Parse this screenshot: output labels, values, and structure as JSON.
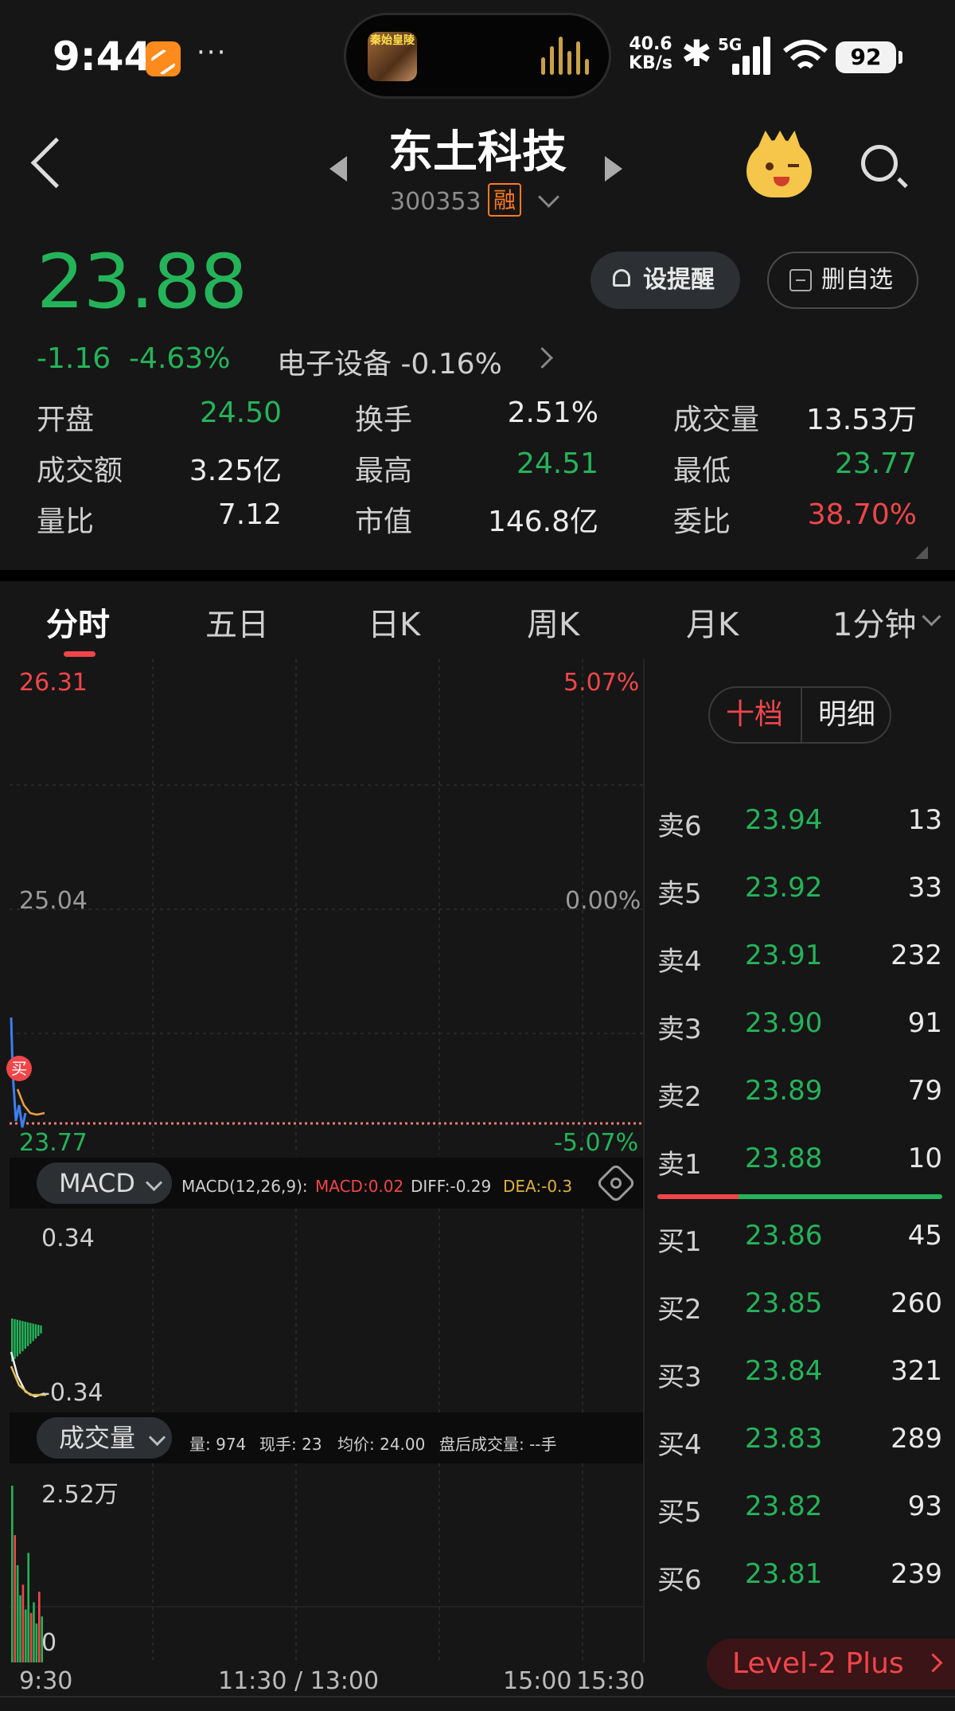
{
  "status_bar": {
    "time": "9:44",
    "dots": "···",
    "island_text": "秦始皇陵",
    "network_speed": "40.6",
    "network_unit": "KB/s",
    "bluetooth": "✱",
    "network_type": "5G",
    "battery": "92"
  },
  "header": {
    "stock_name": "东土科技",
    "stock_code": "300353",
    "margin_badge": "融"
  },
  "quote": {
    "price": "23.88",
    "change": "-1.16",
    "change_pct": "-4.63%",
    "sector": "电子设备 -0.16%",
    "alert_label": "设提醒",
    "remove_label": "删自选"
  },
  "stats": [
    {
      "label": "开盘",
      "value": "24.50",
      "color": "#25b35a"
    },
    {
      "label": "换手",
      "value": "2.51%",
      "color": "#ececec"
    },
    {
      "label": "成交量",
      "value": "13.53万",
      "color": "#ececec"
    },
    {
      "label": "成交额",
      "value": "3.25亿",
      "color": "#ececec"
    },
    {
      "label": "最高",
      "value": "24.51",
      "color": "#25b35a"
    },
    {
      "label": "最低",
      "value": "23.77",
      "color": "#25b35a"
    },
    {
      "label": "量比",
      "value": "7.12",
      "color": "#ececec"
    },
    {
      "label": "市值",
      "value": "146.8亿",
      "color": "#ececec"
    },
    {
      "label": "委比",
      "value": "38.70%",
      "color": "#f0464a"
    }
  ],
  "tabs": [
    "分时",
    "五日",
    "日K",
    "周K",
    "月K",
    "1分钟"
  ],
  "chart": {
    "price_high": "26.31",
    "pct_high": "5.07%",
    "price_mid": "25.04",
    "pct_mid": "0.00%",
    "price_low": "23.77",
    "pct_low": "-5.07%",
    "buy_marker": "买"
  },
  "macd": {
    "selector": "MACD",
    "params": "MACD(12,26,9):",
    "macd": "MACD:0.02",
    "diff": "DIFF:-0.29",
    "dea": "DEA:-0.3",
    "top": "0.34",
    "bottom": "-0.34"
  },
  "volume": {
    "selector": "成交量",
    "qty": "量: 974",
    "current": "现手: 23",
    "avg": "均价: 24.00",
    "after": "盘后成交量: --手",
    "max": "2.52万",
    "zero": "0"
  },
  "time_axis": [
    "9:30",
    "11:30 / 13:00",
    "15:00",
    "15:30"
  ],
  "order_book": {
    "tab_ten": "十档",
    "tab_detail": "明细",
    "asks": [
      {
        "label": "卖6",
        "price": "23.94",
        "qty": "13"
      },
      {
        "label": "卖5",
        "price": "23.92",
        "qty": "33"
      },
      {
        "label": "卖4",
        "price": "23.91",
        "qty": "232"
      },
      {
        "label": "卖3",
        "price": "23.90",
        "qty": "91"
      },
      {
        "label": "卖2",
        "price": "23.89",
        "qty": "79"
      },
      {
        "label": "卖1",
        "price": "23.88",
        "qty": "10"
      }
    ],
    "bids": [
      {
        "label": "买1",
        "price": "23.86",
        "qty": "45"
      },
      {
        "label": "买2",
        "price": "23.85",
        "qty": "260"
      },
      {
        "label": "买3",
        "price": "23.84",
        "qty": "321"
      },
      {
        "label": "买4",
        "price": "23.83",
        "qty": "289"
      },
      {
        "label": "买5",
        "price": "23.82",
        "qty": "93"
      },
      {
        "label": "买6",
        "price": "23.81",
        "qty": "239"
      }
    ],
    "bid_ratio": 0.29
  },
  "level2": "Level-2 Plus"
}
